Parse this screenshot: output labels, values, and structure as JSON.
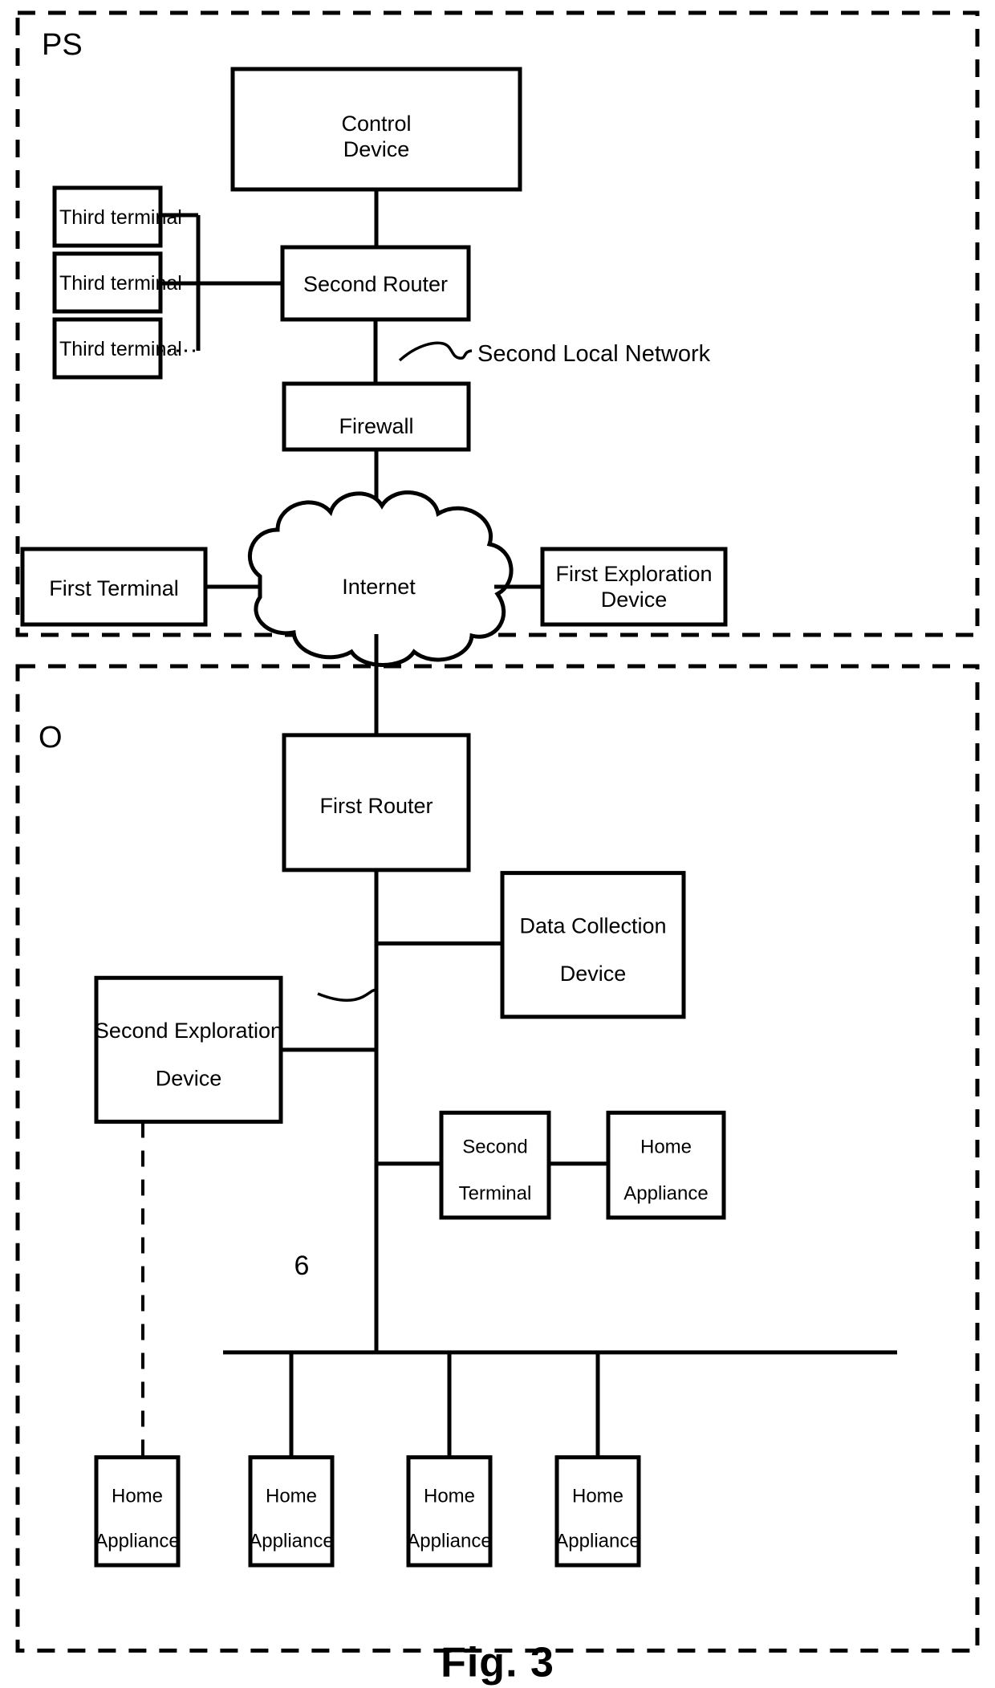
{
  "figure": {
    "caption": "Fig. 3",
    "regions": [
      {
        "id": "ps",
        "label": "PS"
      },
      {
        "id": "o",
        "label": "O"
      }
    ],
    "annotations": [
      {
        "id": "second-local-network",
        "label": "Second Local Network"
      },
      {
        "id": "bus-reference",
        "label": "6"
      }
    ],
    "nodes": {
      "control_device": {
        "label_line1": "Control",
        "label_line2": "Device"
      },
      "second_router": {
        "label": "Second Router"
      },
      "third_terminal_1": {
        "label": "Third terminal"
      },
      "third_terminal_2": {
        "label": "Third terminal"
      },
      "third_terminal_3": {
        "label": "Third terminal"
      },
      "firewall": {
        "label": "Firewall"
      },
      "internet": {
        "label": "Internet"
      },
      "first_terminal": {
        "label": "First Terminal"
      },
      "first_exploration_device": {
        "label_line1": "First Exploration",
        "label_line2": "Device"
      },
      "first_router": {
        "label": "First Router"
      },
      "data_collection_device": {
        "label_line1": "Data Collection",
        "label_line2": "Device"
      },
      "second_exploration_device": {
        "label_line1": "Second Exploration",
        "label_line2": "Device"
      },
      "second_terminal": {
        "label_line1": "Second",
        "label_line2": "Terminal"
      },
      "home_appliance_top": {
        "label_line1": "Home",
        "label_line2": "Appliance"
      },
      "home_appliance_1": {
        "label_line1": "Home",
        "label_line2": "Appliance"
      },
      "home_appliance_2": {
        "label_line1": "Home",
        "label_line2": "Appliance"
      },
      "home_appliance_3": {
        "label_line1": "Home",
        "label_line2": "Appliance"
      },
      "home_appliance_4": {
        "label_line1": "Home",
        "label_line2": "Appliance"
      }
    }
  },
  "colors": {
    "stroke": "#000000",
    "background": "#ffffff"
  }
}
